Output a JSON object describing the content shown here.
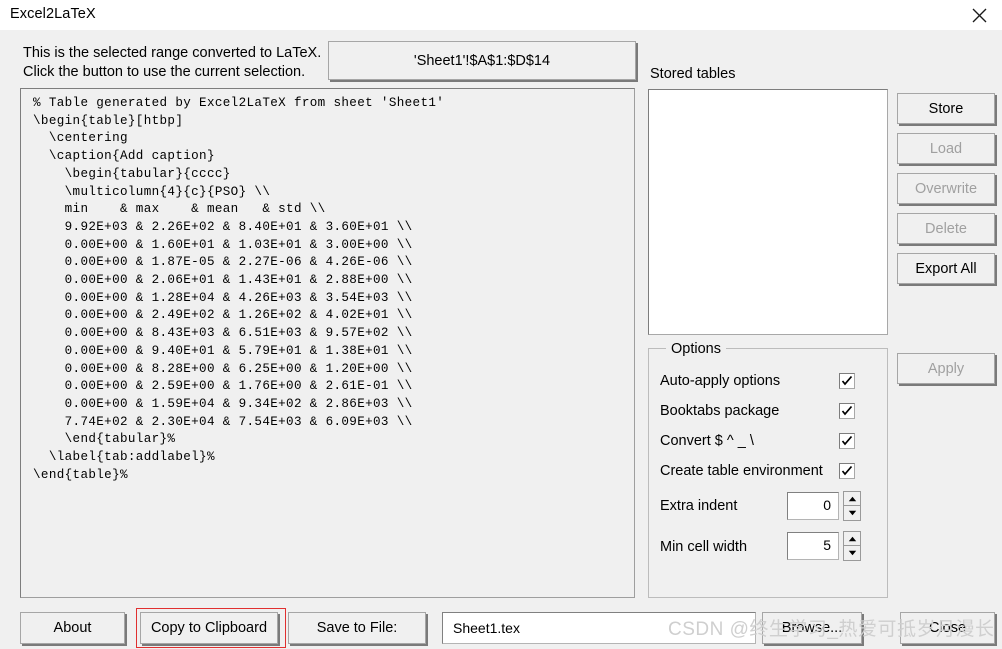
{
  "window": {
    "title": "Excel2LaTeX",
    "close_icon": "close-x-icon"
  },
  "header": {
    "instructions": "This is the selected range converted to LaTeX.\nClick the button to use the current selection.",
    "range_button_label": "'Sheet1'!$A$1:$D$14"
  },
  "latex": {
    "code": "% Table generated by Excel2LaTeX from sheet 'Sheet1'\n\\begin{table}[htbp]\n  \\centering\n  \\caption{Add caption}\n    \\begin{tabular}{cccc}\n    \\multicolumn{4}{c}{PSO} \\\\\n    min    & max    & mean   & std \\\\\n    9.92E+03 & 2.26E+02 & 8.40E+01 & 3.60E+01 \\\\\n    0.00E+00 & 1.60E+01 & 1.03E+01 & 3.00E+00 \\\\\n    0.00E+00 & 1.87E-05 & 2.27E-06 & 4.26E-06 \\\\\n    0.00E+00 & 2.06E+01 & 1.43E+01 & 2.88E+00 \\\\\n    0.00E+00 & 1.28E+04 & 4.26E+03 & 3.54E+03 \\\\\n    0.00E+00 & 2.49E+02 & 1.26E+02 & 4.02E+01 \\\\\n    0.00E+00 & 8.43E+03 & 6.51E+03 & 9.57E+02 \\\\\n    0.00E+00 & 9.40E+01 & 5.79E+01 & 1.38E+01 \\\\\n    0.00E+00 & 8.28E+00 & 6.25E+00 & 1.20E+00 \\\\\n    0.00E+00 & 2.59E+00 & 1.76E+00 & 2.61E-01 \\\\\n    0.00E+00 & 1.59E+04 & 9.34E+02 & 2.86E+03 \\\\\n    7.74E+02 & 2.30E+04 & 7.54E+03 & 6.09E+03 \\\\\n    \\end{tabular}%\n  \\label{tab:addlabel}%\n\\end{table}%"
  },
  "stored": {
    "label": "Stored tables",
    "items": []
  },
  "side_buttons": {
    "store": "Store",
    "load": "Load",
    "overwrite": "Overwrite",
    "delete": "Delete",
    "export_all": "Export All",
    "apply": "Apply"
  },
  "options": {
    "legend": "Options",
    "auto_apply_label": "Auto-apply options",
    "auto_apply_checked": true,
    "booktabs_label": "Booktabs package",
    "booktabs_checked": true,
    "convert_label": "Convert $ ^ _ \\",
    "convert_checked": true,
    "create_env_label": "Create table environment",
    "create_env_checked": true,
    "extra_indent_label": "Extra indent",
    "extra_indent_value": "0",
    "min_cell_width_label": "Min cell width",
    "min_cell_width_value": "5"
  },
  "bottom": {
    "about": "About",
    "copy_to_clipboard": "Copy to Clipboard",
    "save_to_file": "Save to File:",
    "filename_value": "Sheet1.tex",
    "browse": "Browse...",
    "close": "Close"
  },
  "watermark": {
    "text": "CSDN @终生学习_热爱可抵岁月漫长"
  },
  "colors": {
    "dialog_bg": "#f0f0f0",
    "highlight": "#e03030",
    "disabled_text": "#a0a0a0"
  }
}
